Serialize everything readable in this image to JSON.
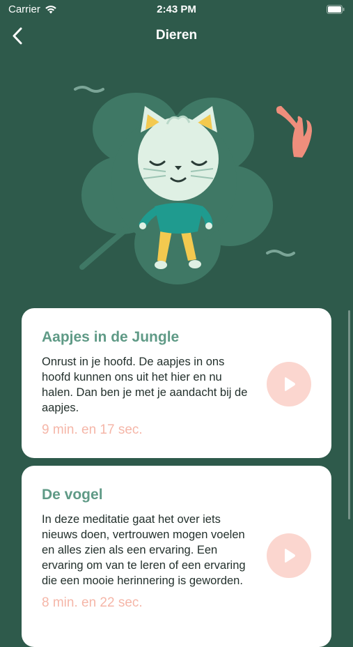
{
  "status_bar": {
    "carrier": "Carrier",
    "time": "2:43 PM"
  },
  "nav": {
    "title": "Dieren"
  },
  "colors": {
    "background": "#2e5a4b",
    "card_title": "#5f9a86",
    "duration": "#f5b6a8",
    "play_button": "#fbd6cf",
    "leaf": "#3f7865"
  },
  "icons": {
    "back": "chevron-left-icon",
    "play": "play-icon",
    "wifi": "wifi-icon",
    "battery": "battery-icon"
  },
  "meditations": [
    {
      "title": "Aapjes in de Jungle",
      "description": "Onrust in je hoofd. De aapjes in ons hoofd kunnen ons uit het hier en nu halen. Dan ben je met je aandacht bij de aapjes.",
      "duration": "9 min. en 17 sec."
    },
    {
      "title": "De vogel",
      "description": "In deze meditatie gaat het over iets nieuws doen, vertrouwen mogen voelen en alles zien als een ervaring. Een ervaring om van te leren of een ervaring die een mooie herinnering is geworden.",
      "duration": "8 min. en 22 sec."
    }
  ]
}
